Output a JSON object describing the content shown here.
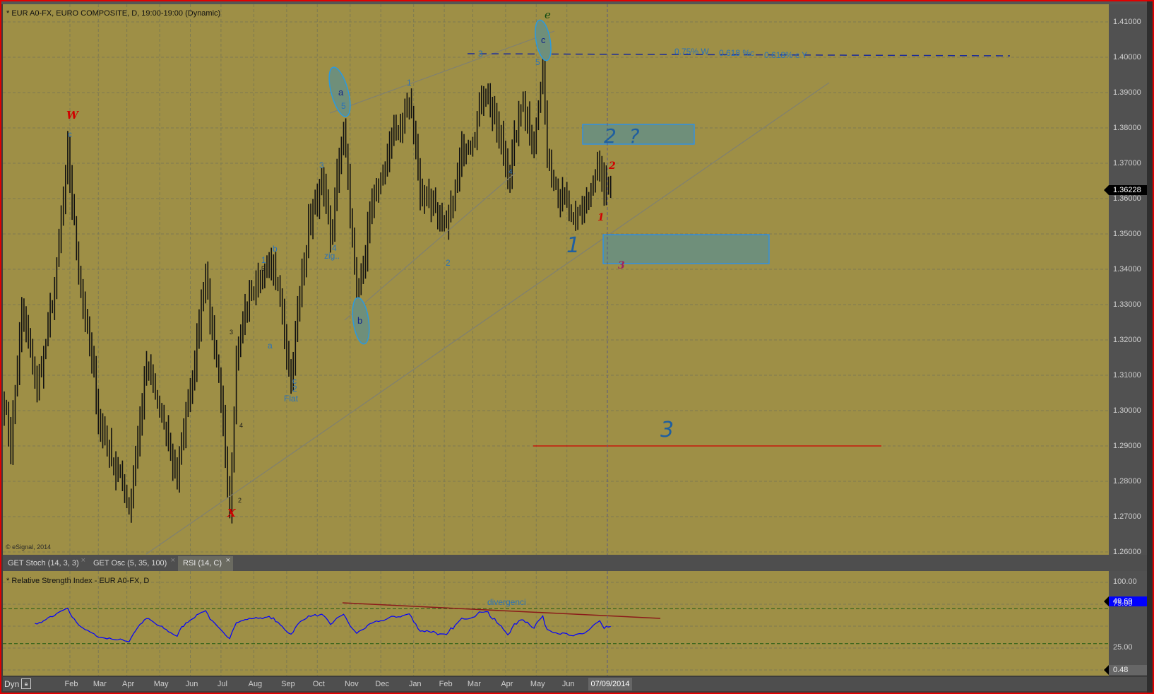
{
  "header": {
    "title": "* EUR A0-FX, EURO COMPOSITE, D, 19:00-19:00 (Dynamic)",
    "copyright": "© eSignal, 2014"
  },
  "tabs": [
    {
      "label": "GET Stoch (14, 3, 3)",
      "active": false
    },
    {
      "label": "GET Osc (5, 35, 100)",
      "active": false
    },
    {
      "label": "RSI (14, C)",
      "active": true
    }
  ],
  "rsi_panel": {
    "title": "* Relative Strength Index - EUR A0-FX, D",
    "current": "49.69",
    "min_label": "0.48",
    "annotation": "divergenci"
  },
  "price_axis": {
    "current": "1.36228"
  },
  "time_axis": {
    "mode": "Dyn",
    "cursor_date": "07/09/2014"
  },
  "annotations": {
    "w": "W",
    "w_c": "c",
    "x": "X",
    "s1": "1",
    "s5": "5",
    "sb": "b",
    "sa": "a",
    "s3": "3",
    "s4": "4",
    "s2": "2",
    "flat_c": "c",
    "flat_2": "2",
    "flat": "Flat",
    "m3": "3",
    "m4": "4",
    "zig": "zig..",
    "ell_a": "a",
    "ell_a5": "5",
    "ell_b": "b",
    "ell_c": "c",
    "ell_c5": "5",
    "e": "e",
    "u1": "1",
    "u2": "2",
    "u4": "4",
    "u3": "3",
    "fib1": "0.75% W",
    "fib2": "0.618 %c",
    "fib3": "0.618% c Y",
    "box_label": "2  ?",
    "r2": "2",
    "r1": "1",
    "r3": "3",
    "big1": "1",
    "big3": "3"
  },
  "colors": {
    "background": "#9e8f46",
    "bars": "#111111",
    "rsi_line": "#0000ff",
    "divergence": "#8b1a1a",
    "target_line": "#d00000",
    "zone_fill": "#6f8f7a",
    "zone_border": "#1e90ff"
  },
  "chart_data": {
    "type": "ohlc",
    "title": "EUR A0-FX, EURO COMPOSITE, D",
    "y_ticks": [
      "1.41000",
      "1.40000",
      "1.39000",
      "1.38000",
      "1.37000",
      "1.36000",
      "1.35000",
      "1.34000",
      "1.33000",
      "1.32000",
      "1.31000",
      "1.30000",
      "1.29000",
      "1.28000",
      "1.27000",
      "1.26000"
    ],
    "ylim": [
      1.2575,
      1.4162
    ],
    "x_ticks": [
      {
        "label": "Feb",
        "bar": 30
      },
      {
        "label": "Mar",
        "bar": 43
      },
      {
        "label": "Apr",
        "bar": 56
      },
      {
        "label": "May",
        "bar": 71
      },
      {
        "label": "Jun",
        "bar": 85
      },
      {
        "label": "Jul",
        "bar": 99
      },
      {
        "label": "Aug",
        "bar": 114
      },
      {
        "label": "Sep",
        "bar": 129
      },
      {
        "label": "Oct",
        "bar": 143
      },
      {
        "label": "Nov",
        "bar": 158
      },
      {
        "label": "Dec",
        "bar": 172
      },
      {
        "label": "Jan",
        "bar": 187
      },
      {
        "label": "Feb",
        "bar": 201
      },
      {
        "label": "Mar",
        "bar": 214
      },
      {
        "label": "Apr",
        "bar": 229
      },
      {
        "label": "May",
        "bar": 243
      },
      {
        "label": "Jun",
        "bar": 257
      }
    ],
    "close_waypoints": [
      [
        0,
        1.3036
      ],
      [
        3,
        1.291
      ],
      [
        8,
        1.3265
      ],
      [
        15,
        1.3057
      ],
      [
        23,
        1.3331
      ],
      [
        29,
        1.3697
      ],
      [
        33,
        1.3457
      ],
      [
        43,
        1.2977
      ],
      [
        57,
        1.2738
      ],
      [
        65,
        1.312
      ],
      [
        79,
        1.281
      ],
      [
        92,
        1.3393
      ],
      [
        97,
        1.31
      ],
      [
        103,
        1.2748
      ],
      [
        106,
        1.318
      ],
      [
        112,
        1.332
      ],
      [
        118,
        1.3393
      ],
      [
        123,
        1.341
      ],
      [
        131,
        1.31
      ],
      [
        139,
        1.354
      ],
      [
        145,
        1.362
      ],
      [
        149,
        1.3455
      ],
      [
        155,
        1.381
      ],
      [
        161,
        1.331
      ],
      [
        166,
        1.35
      ],
      [
        176,
        1.374
      ],
      [
        185,
        1.387
      ],
      [
        190,
        1.364
      ],
      [
        196,
        1.36
      ],
      [
        202,
        1.348
      ],
      [
        210,
        1.374
      ],
      [
        220,
        1.393
      ],
      [
        230,
        1.367
      ],
      [
        237,
        1.387
      ],
      [
        242,
        1.379
      ],
      [
        246,
        1.395
      ],
      [
        248,
        1.374
      ],
      [
        254,
        1.364
      ],
      [
        260,
        1.35
      ],
      [
        267,
        1.36
      ],
      [
        272,
        1.368
      ],
      [
        274,
        1.3575
      ],
      [
        277,
        1.36228
      ]
    ],
    "rsi": {
      "period": 14,
      "y_ticks": [
        "100.00",
        "75.00",
        "25.00"
      ],
      "levels": [
        70,
        30
      ],
      "last": 49.69
    }
  }
}
